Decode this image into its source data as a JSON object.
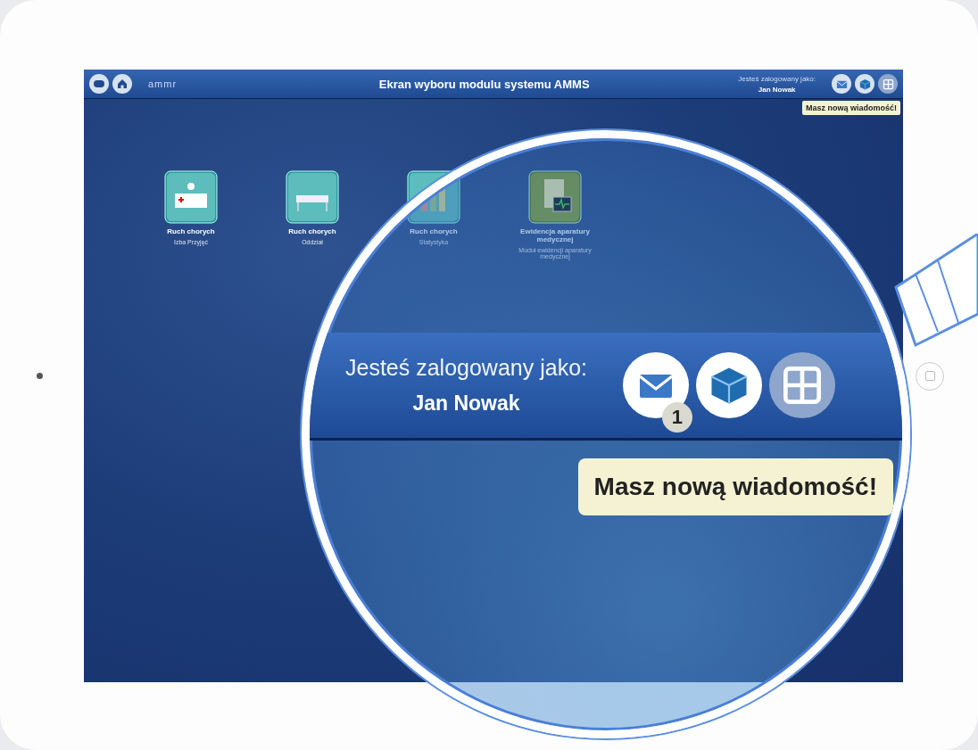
{
  "header": {
    "logo": "ammr",
    "title": "Ekran wyboru modulu systemu AMMS",
    "user_label": "Jesteś zalogowany jako:",
    "user_name": "Jan Nowak",
    "tooltip": "Masz nową wiadomość!"
  },
  "modules": [
    {
      "kind": "admission",
      "title": "Ruch chorych",
      "subtitle": "Izba Przyjęć"
    },
    {
      "kind": "ward",
      "title": "Ruch chorych",
      "subtitle": "Oddział"
    },
    {
      "kind": "statistics",
      "title": "Ruch chorych",
      "subtitle": "Statystyka"
    },
    {
      "kind": "equipment",
      "title": "Ewidencja aparatury medycznej",
      "subtitle": "Moduł ewidencji aparatury medycznej"
    }
  ],
  "magnifier": {
    "user_label": "Jesteś zalogowany jako:",
    "user_name": "Jan Nowak",
    "message_count": "1",
    "tooltip": "Masz nową wiadomość!"
  }
}
